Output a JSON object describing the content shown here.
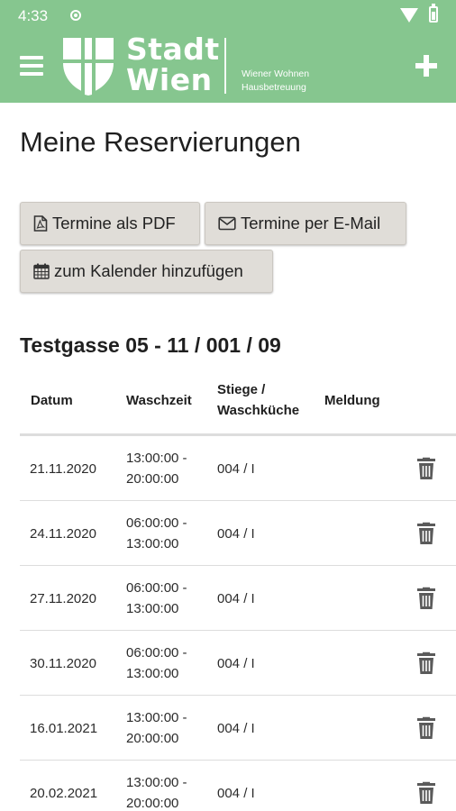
{
  "status": {
    "time": "4:33"
  },
  "app_bar": {
    "brand_line1": "Stadt",
    "brand_line2": "Wien",
    "subtitle_line1": "Wiener Wohnen",
    "subtitle_line2": "Hausbetreuung",
    "menu_icon": "hamburger-menu-icon",
    "add_icon": "plus-icon",
    "colors": {
      "bar": "#86c68f",
      "foreground": "#ffffff"
    }
  },
  "page": {
    "title": "Meine Reservierungen"
  },
  "actions": {
    "pdf_label": "Termine als PDF",
    "mail_label": "Termine per E-Mail",
    "calendar_label": "zum Kalender hinzufügen",
    "pdf_icon": "pdf-file-icon",
    "mail_icon": "envelope-icon",
    "calendar_icon": "calendar-icon",
    "button_bg": "#e0ddd8"
  },
  "location": {
    "title": "Testgasse 05 - 11 / 001 / 09"
  },
  "table": {
    "headers": {
      "datum": "Datum",
      "waschzeit": "Waschzeit",
      "stiege_line1": "Stiege /",
      "stiege_line2": "Waschküche",
      "meldung": "Meldung"
    },
    "rows": [
      {
        "date": "21.11.2020",
        "time_from": "13:00:00 -",
        "time_to": "20:00:00",
        "stiege": "004 / I",
        "meldung": ""
      },
      {
        "date": "24.11.2020",
        "time_from": "06:00:00 -",
        "time_to": "13:00:00",
        "stiege": "004 / I",
        "meldung": ""
      },
      {
        "date": "27.11.2020",
        "time_from": "06:00:00 -",
        "time_to": "13:00:00",
        "stiege": "004 / I",
        "meldung": ""
      },
      {
        "date": "30.11.2020",
        "time_from": "06:00:00 -",
        "time_to": "13:00:00",
        "stiege": "004 / I",
        "meldung": ""
      },
      {
        "date": "16.01.2021",
        "time_from": "13:00:00 -",
        "time_to": "20:00:00",
        "stiege": "004 / I",
        "meldung": ""
      },
      {
        "date": "20.02.2021",
        "time_from": "13:00:00 -",
        "time_to": "20:00:00",
        "stiege": "004 / I",
        "meldung": ""
      }
    ],
    "delete_icon": "trash-icon"
  }
}
